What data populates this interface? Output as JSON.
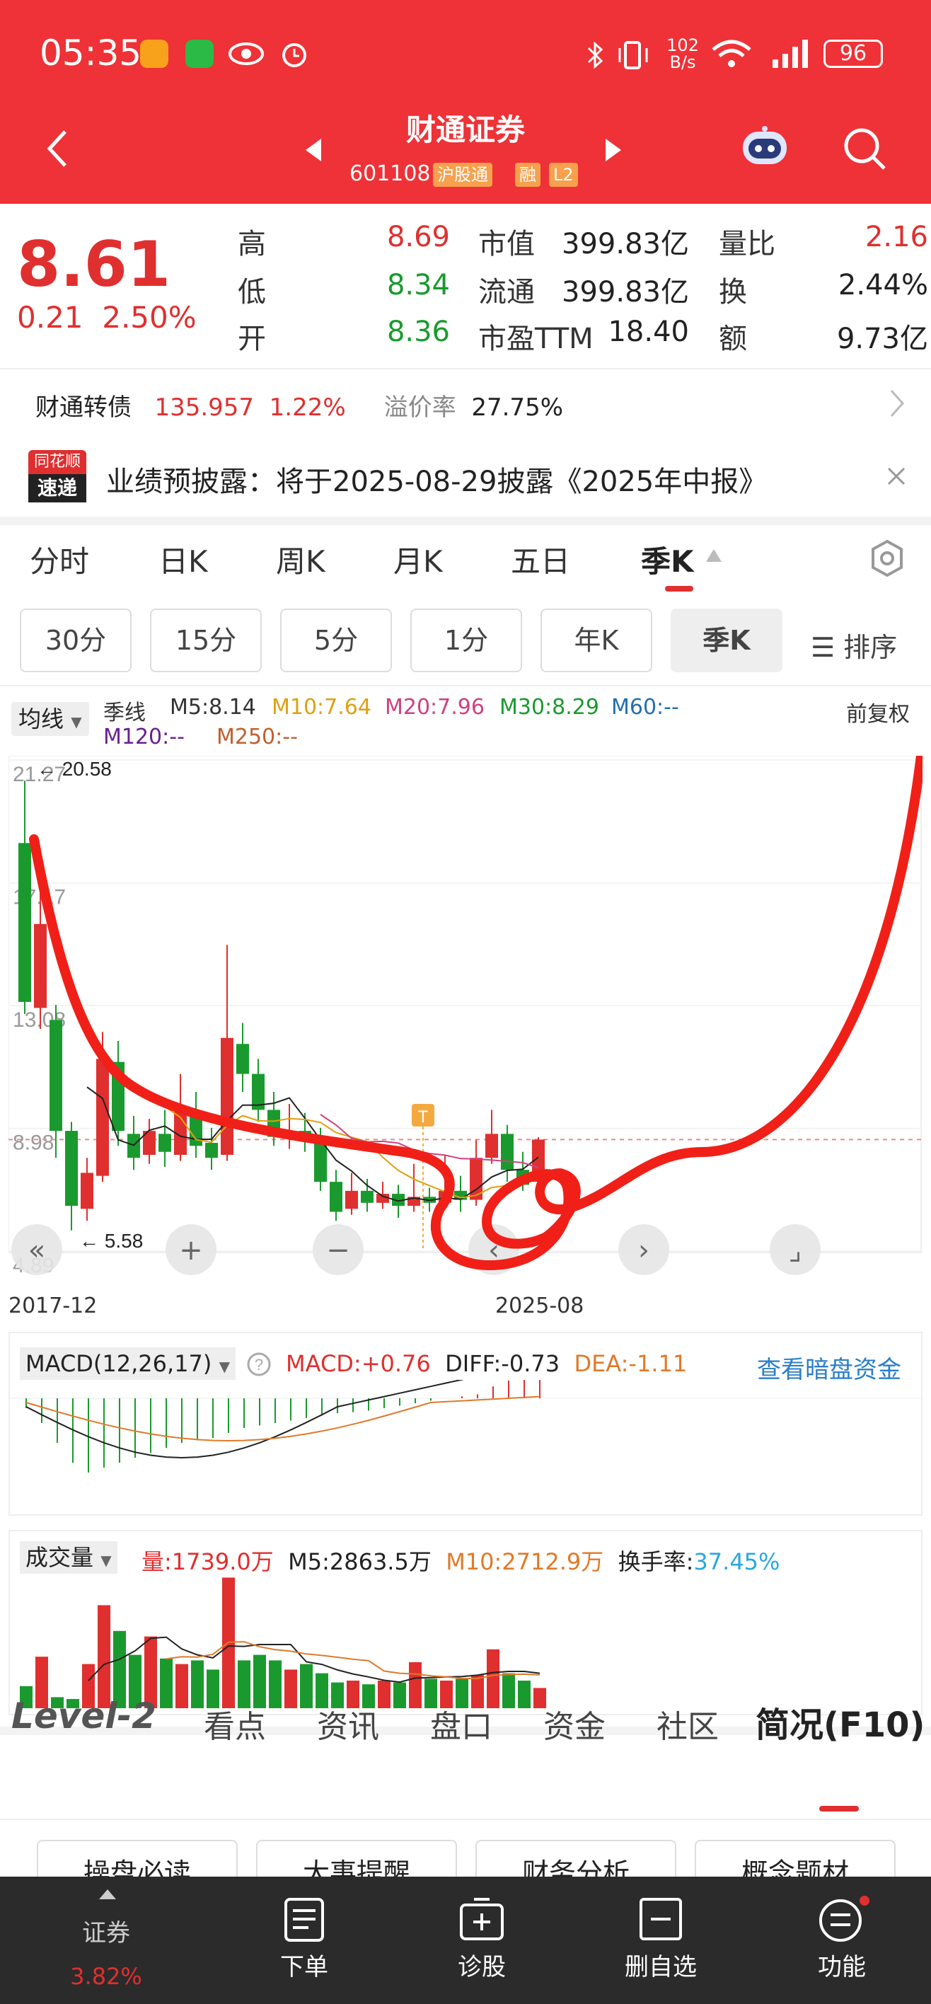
{
  "status": {
    "time": "05:35",
    "net_speed_top": "102",
    "net_speed_bottom": "B/s",
    "battery": "96"
  },
  "header": {
    "title": "财通证券",
    "code": "601108",
    "tags": [
      "沪股通",
      "融",
      "L2"
    ]
  },
  "quote": {
    "price": "8.61",
    "change": "0.21",
    "change_pct": "2.50%",
    "rows": [
      {
        "l1": "高",
        "v1": "8.69",
        "l2": "市值",
        "v2": "399.83亿",
        "l3": "量比",
        "v3": "2.16"
      },
      {
        "l1": "低",
        "v1": "8.34",
        "l2": "流通",
        "v2": "399.83亿",
        "l3": "换",
        "v3": "2.44%"
      },
      {
        "l1": "开",
        "v1": "8.36",
        "l2": "市盈TTM",
        "v2": "18.40",
        "l3": "额",
        "v3": "9.73亿"
      }
    ],
    "colors": {
      "up": "#e02f2f",
      "down": "#1a9a2e"
    }
  },
  "convertible": {
    "name": "财通转债",
    "price": "135.957",
    "pct": "1.22%",
    "premium_label": "溢价率",
    "premium": "27.75%"
  },
  "notice": {
    "logo_top": "同花顺",
    "logo_bottom": "速递",
    "text": "业绩预披露：将于2025-08-29披露《2025年中报》"
  },
  "k_tabs": [
    "分时",
    "日K",
    "周K",
    "月K",
    "五日",
    "季K"
  ],
  "period_buttons": [
    "30分",
    "15分",
    "5分",
    "1分",
    "年K",
    "季K"
  ],
  "sort_label": "排序",
  "ma": {
    "selector": "均线",
    "line": "季线",
    "items": [
      {
        "label": "M5:8.14",
        "color": "#333333"
      },
      {
        "label": "M10:7.64",
        "color": "#e0a010"
      },
      {
        "label": "M20:7.96",
        "color": "#d04080"
      },
      {
        "label": "M30:8.29",
        "color": "#1a9a2e"
      },
      {
        "label": "M60:--",
        "color": "#2070b0"
      },
      {
        "label": "M120:--",
        "color": "#6a2090"
      },
      {
        "label": "M250:--",
        "color": "#c06030"
      }
    ],
    "adjust": "前复权"
  },
  "kchart": {
    "y_ticks": [
      "21.27",
      "17.17",
      "13.08",
      "8.98",
      "4.89"
    ],
    "max_label": "20.58",
    "min_label": "5.58",
    "x_start": "2017-12",
    "x_end": "2025-08",
    "marker": "T"
  },
  "macd": {
    "selector": "MACD(12,26,17)",
    "macd": "MACD:+0.76",
    "diff": "DIFF:-0.73",
    "dea": "DEA:-1.11",
    "link": "查看暗盘资金"
  },
  "volume": {
    "selector": "成交量",
    "vol": "量:1739.0万",
    "m5": "M5:2863.5万",
    "m10": "M10:2712.9万",
    "turnover_label": "换手率:",
    "turnover": "37.45%"
  },
  "bottom_tabs": [
    "Level-2",
    "看点",
    "资讯",
    "盘口",
    "资金",
    "社区",
    "简况(F10)"
  ],
  "chips": [
    "操盘必读",
    "大事提醒",
    "财务分析",
    "概念题材"
  ],
  "nav": [
    {
      "label": "证券",
      "sub": "3.82%"
    },
    {
      "label": "下单"
    },
    {
      "label": "诊股"
    },
    {
      "label": "删自选"
    },
    {
      "label": "功能"
    }
  ],
  "chart_data": {
    "type": "candlestick",
    "period": "季K",
    "x_start": "2017-12",
    "x_end": "2025-08",
    "y_range": [
      4.89,
      21.27
    ],
    "candles": [
      {
        "o": 18.5,
        "c": 13.2,
        "h": 20.58,
        "l": 12.8
      },
      {
        "o": 13.0,
        "c": 15.8,
        "h": 17.5,
        "l": 12.3
      },
      {
        "o": 12.6,
        "c": 8.9,
        "h": 13.1,
        "l": 8.0
      },
      {
        "o": 8.9,
        "c": 6.4,
        "h": 9.2,
        "l": 5.58
      },
      {
        "o": 6.3,
        "c": 7.5,
        "h": 8.0,
        "l": 5.9
      },
      {
        "o": 7.4,
        "c": 11.3,
        "h": 12.2,
        "l": 7.2
      },
      {
        "o": 11.2,
        "c": 8.9,
        "h": 11.9,
        "l": 8.4
      },
      {
        "o": 8.8,
        "c": 8.0,
        "h": 9.4,
        "l": 7.6
      },
      {
        "o": 8.1,
        "c": 8.9,
        "h": 9.3,
        "l": 7.8
      },
      {
        "o": 8.8,
        "c": 8.2,
        "h": 9.6,
        "l": 7.7
      },
      {
        "o": 8.1,
        "c": 9.6,
        "h": 10.8,
        "l": 7.9
      },
      {
        "o": 9.4,
        "c": 8.4,
        "h": 10.2,
        "l": 8.0
      },
      {
        "o": 8.5,
        "c": 8.0,
        "h": 9.0,
        "l": 7.6
      },
      {
        "o": 8.1,
        "c": 12.0,
        "h": 15.1,
        "l": 7.9
      },
      {
        "o": 11.8,
        "c": 10.8,
        "h": 12.5,
        "l": 10.2
      },
      {
        "o": 10.8,
        "c": 9.6,
        "h": 11.3,
        "l": 9.2
      },
      {
        "o": 9.6,
        "c": 8.7,
        "h": 10.2,
        "l": 8.4
      },
      {
        "o": 8.8,
        "c": 8.9,
        "h": 9.8,
        "l": 8.3
      },
      {
        "o": 8.9,
        "c": 8.6,
        "h": 9.5,
        "l": 8.2
      },
      {
        "o": 8.6,
        "c": 7.2,
        "h": 9.0,
        "l": 6.9
      },
      {
        "o": 7.2,
        "c": 6.2,
        "h": 7.6,
        "l": 5.9
      },
      {
        "o": 6.3,
        "c": 6.9,
        "h": 7.5,
        "l": 6.1
      },
      {
        "o": 6.9,
        "c": 6.5,
        "h": 7.3,
        "l": 6.2
      },
      {
        "o": 6.5,
        "c": 6.8,
        "h": 7.2,
        "l": 6.3
      },
      {
        "o": 6.8,
        "c": 6.4,
        "h": 7.1,
        "l": 6.0
      },
      {
        "o": 6.4,
        "c": 6.7,
        "h": 7.8,
        "l": 6.2
      },
      {
        "o": 6.7,
        "c": 6.5,
        "h": 7.0,
        "l": 6.2
      },
      {
        "o": 6.5,
        "c": 6.9,
        "h": 8.1,
        "l": 6.3
      },
      {
        "o": 6.9,
        "c": 6.6,
        "h": 7.4,
        "l": 6.2
      },
      {
        "o": 6.6,
        "c": 8.0,
        "h": 8.6,
        "l": 6.4
      },
      {
        "o": 8.0,
        "c": 8.8,
        "h": 9.6,
        "l": 7.8
      },
      {
        "o": 8.8,
        "c": 7.6,
        "h": 9.1,
        "l": 7.2
      },
      {
        "o": 7.6,
        "c": 7.1,
        "h": 8.2,
        "l": 6.9
      },
      {
        "o": 7.2,
        "c": 8.61,
        "h": 8.69,
        "l": 6.9
      }
    ],
    "macd_hist": [
      -0.2,
      -0.5,
      -0.9,
      -1.3,
      -1.5,
      -1.4,
      -1.3,
      -1.2,
      -1.1,
      -1.0,
      -0.9,
      -0.85,
      -0.8,
      -0.7,
      -0.6,
      -0.55,
      -0.5,
      -0.45,
      -0.4,
      -0.35,
      -0.3,
      -0.28,
      -0.25,
      -0.2,
      -0.15,
      -0.1,
      -0.05,
      0.0,
      0.05,
      0.1,
      0.3,
      0.45,
      0.6,
      0.76
    ],
    "volume": [
      1.2,
      2.8,
      0.6,
      0.5,
      2.4,
      5.6,
      4.2,
      2.9,
      3.9,
      2.7,
      2.4,
      2.6,
      2.1,
      7.1,
      2.6,
      2.9,
      2.6,
      2.1,
      2.4,
      1.9,
      1.4,
      1.5,
      1.3,
      1.5,
      1.4,
      2.5,
      1.6,
      1.5,
      1.6,
      1.8,
      3.2,
      1.9,
      1.5,
      1.1
    ],
    "volume_unit": "千万"
  }
}
